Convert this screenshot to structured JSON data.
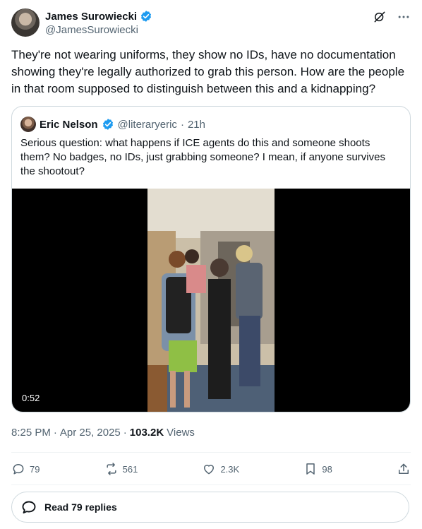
{
  "author": {
    "name": "James Surowiecki",
    "handle": "@JamesSurowiecki"
  },
  "tweet": {
    "text": "They're not wearing uniforms, they show no IDs, have no documentation showing they're legally authorized to grab this person. How are the people in that room supposed to distinguish between this and a kidnapping?"
  },
  "quote": {
    "name": "Eric Nelson",
    "handle": "@literaryeric",
    "separator": "·",
    "time": "21h",
    "text": "Serious question: what happens if ICE agents do this and someone shoots them? No badges, no IDs, just grabbing someone? I mean, if anyone survives the shootout?",
    "video_duration": "0:52"
  },
  "meta": {
    "time": "8:25 PM",
    "separator": "·",
    "date": "Apr 25, 2025",
    "separator2": "·",
    "views_count": "103.2K",
    "views_label": "Views"
  },
  "actions": {
    "replies": "79",
    "reposts": "561",
    "likes": "2.3K",
    "bookmarks": "98"
  },
  "read_replies": {
    "label": "Read 79 replies"
  },
  "colors": {
    "verified": "#1d9bf0",
    "muted": "#536471",
    "border": "#cfd9de"
  }
}
